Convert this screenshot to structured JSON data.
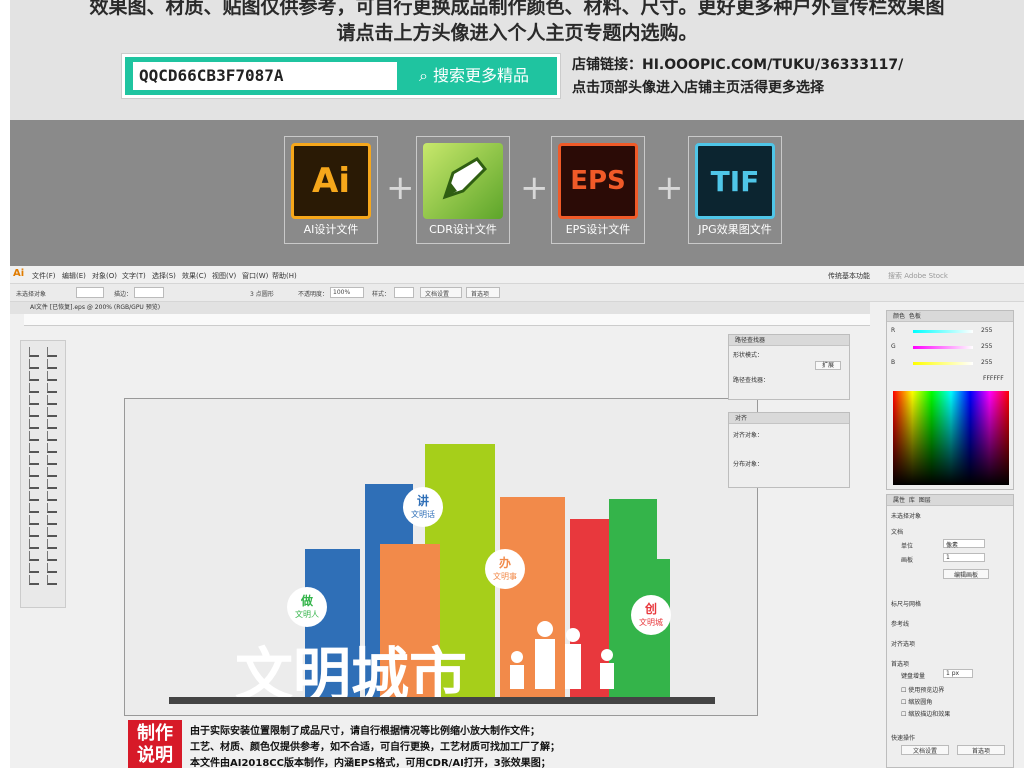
{
  "banner": {
    "line1": "效果图、材质、贴图仅供参考，可自行更换成品制作颜色、材料、尺寸。更好更多种户外宣传栏效果图",
    "line2": "请点击上方头像进入个人主页专题内选购。",
    "search_code": "QQCD66CB3F7087A",
    "search_button": "搜索更多精品",
    "shop_link_label": "店铺链接：HI.OOOPIC.COM/TUKU/36333117/",
    "shop_note": "点击顶部头像进入店铺主页活得更多选择"
  },
  "formats": [
    {
      "icon": "Ai",
      "label": "AI设计文件",
      "bg": "#2a1a05",
      "fg": "#f6a71b"
    },
    {
      "icon": "CDR",
      "label": "CDR设计文件",
      "bg": "#8bc53f",
      "fg": "#ffffff"
    },
    {
      "icon": "EPS",
      "label": "EPS设计文件",
      "bg": "#2b0b06",
      "fg": "#f05a28"
    },
    {
      "icon": "TIF",
      "label": "JPG效果图文件",
      "bg": "#0c2530",
      "fg": "#4fc6e8"
    }
  ],
  "plus_symbol": "+",
  "editor": {
    "app_logo": "Ai",
    "menus": [
      "文件(F)",
      "编辑(E)",
      "对象(O)",
      "文字(T)",
      "选择(S)",
      "效果(C)",
      "视图(V)",
      "窗口(W)",
      "帮助(H)"
    ],
    "workspace": "传统基本功能",
    "search_placeholder": "搜索 Adobe Stock",
    "control": {
      "selection": "未选择对象",
      "stroke_label": "描边：",
      "brush": "3 点圆形",
      "opacity_label": "不透明度：",
      "opacity": "100%",
      "style_label": "样式：",
      "doc_setup": "文档设置",
      "prefs": "首选项"
    },
    "doc_tab": "AI文件 [已恢复].eps @ 200% (RGB/GPU 预览)"
  },
  "artwork": {
    "title": "文明城市",
    "badges": [
      {
        "big": "讲",
        "small": "文明话"
      },
      {
        "big": "办",
        "small": "文明事"
      },
      {
        "big": "做",
        "small": "文明人"
      },
      {
        "big": "创",
        "small": "文明城"
      }
    ],
    "colors": {
      "blue": "#2f6fb7",
      "lime": "#a6cf1a",
      "orange": "#f28a4a",
      "green": "#34b44a",
      "red": "#e8383d",
      "pink": "#f5a6a3"
    }
  },
  "panels": {
    "pathfinder": {
      "title": "路径查找器",
      "shape_modes": "形状模式：",
      "pathfinders": "路径查找器：",
      "expand": "扩展"
    },
    "align": {
      "title": "对齐",
      "align_objects": "对齐对象：",
      "distribute_objects": "分布对象："
    },
    "color": {
      "tabs": [
        "颜色",
        "色板"
      ],
      "channels": [
        {
          "name": "R",
          "value": "255"
        },
        {
          "name": "G",
          "value": "255"
        },
        {
          "name": "B",
          "value": "255"
        }
      ],
      "hex": "FFFFFF"
    },
    "properties": {
      "tabs": [
        "属性",
        "库",
        "图层"
      ],
      "no_selection": "未选择对象",
      "document": "文档",
      "unit_label": "单位",
      "unit_value": "像素",
      "artboard_label": "画板",
      "artboard_value": "1",
      "edit_artboard": "编辑画板",
      "ruler_grid": "标尺与网格",
      "guides": "参考线",
      "snap": "对齐选项",
      "prefs": "首选项",
      "keyboard_inc_label": "键盘增量",
      "keyboard_inc": "1 px",
      "checkboxes": [
        "使用预览边界",
        "缩放圆角",
        "缩放描边和效果"
      ],
      "quick_actions": "快速操作",
      "doc_setup_btn": "文档设置",
      "prefs_btn": "首选项"
    }
  },
  "instructions": {
    "badge": "制作说明",
    "badge_line1": "制作",
    "badge_line2": "说明",
    "lines": [
      "由于实际安装位置限制了成品尺寸，请自行根据情况等比例缩小放大制作文件；",
      "工艺、材质、颜色仅提供参考，如不合适，可自行更换，工艺材质可找加工厂了解；",
      "本文件由AI2018CC版本制作，内涵EPS格式，可用CDR/AI打开，3张效果图；"
    ]
  }
}
